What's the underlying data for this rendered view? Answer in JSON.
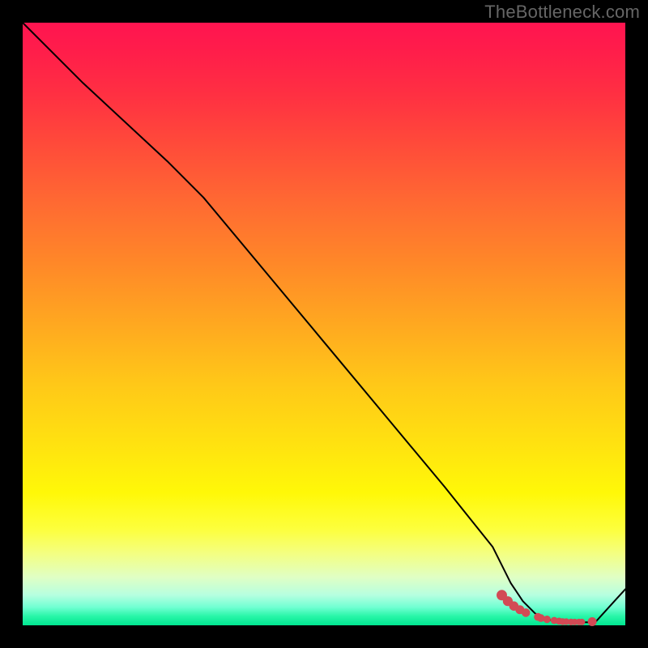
{
  "watermark": "TheBottleneck.com",
  "chart_data": {
    "type": "line",
    "title": "",
    "xlabel": "",
    "ylabel": "",
    "xlim": [
      0,
      100
    ],
    "ylim": [
      0,
      100
    ],
    "grid": false,
    "legend": false,
    "background": "rainbow-vertical",
    "series": [
      {
        "name": "curve",
        "x": [
          0,
          10,
          24,
          30,
          40,
          50,
          60,
          70,
          78,
          81,
          83,
          85,
          87,
          89,
          91,
          93,
          95,
          100
        ],
        "values": [
          100,
          90,
          77,
          71,
          59,
          47,
          35,
          23,
          13,
          7,
          4,
          2,
          1,
          0.6,
          0.5,
          0.5,
          0.5,
          6
        ]
      }
    ],
    "marker_cluster": {
      "note": "dense dot cluster along the flat trough",
      "x": [
        79.5,
        80.5,
        81.5,
        82.5,
        83.5,
        85.5,
        86.0,
        87.0,
        88.2,
        89.0,
        89.6,
        90.2,
        91.0,
        91.6,
        92.3,
        92.8,
        94.5
      ],
      "values": [
        5.0,
        4.0,
        3.2,
        2.6,
        2.1,
        1.4,
        1.2,
        1.0,
        0.8,
        0.7,
        0.6,
        0.6,
        0.55,
        0.55,
        0.55,
        0.55,
        0.6
      ],
      "radius": [
        6.0,
        5.6,
        5.3,
        5.0,
        4.8,
        4.4,
        4.3,
        4.1,
        3.9,
        3.8,
        3.7,
        3.6,
        3.6,
        3.5,
        3.5,
        3.5,
        5.0
      ]
    }
  },
  "colors": {
    "top": "#ff1450",
    "mid": "#ffe210",
    "bottom": "#00e690",
    "line": "#000000",
    "dot": "#d24a55",
    "frame": "#000000"
  }
}
